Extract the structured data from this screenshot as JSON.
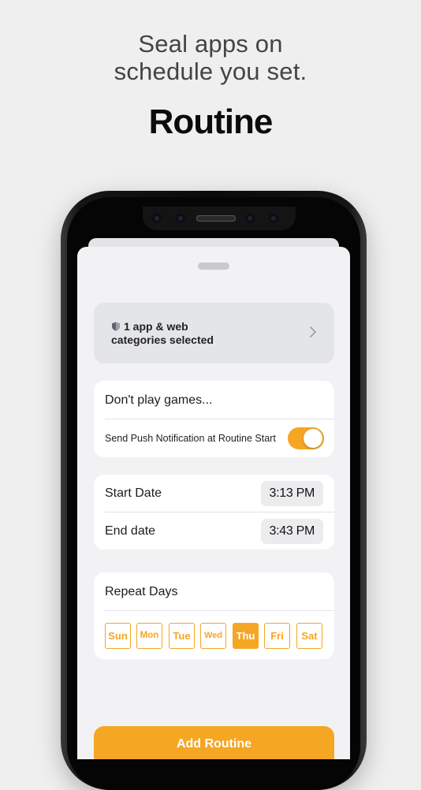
{
  "headline": {
    "line1": "Seal apps on",
    "line2": "schedule you set.",
    "title": "Routine"
  },
  "sheet": {
    "apps_line1": "1 app & web",
    "apps_line2": "categories selected",
    "routine_name": "Don't play games...",
    "push_label": "Send Push Notification at Routine Start",
    "push_enabled": true,
    "start_label": "Start Date",
    "start_time": "3:13 PM",
    "end_label": "End date",
    "end_time": "3:43 PM",
    "repeat_label": "Repeat Days",
    "days": [
      "Sun",
      "Mon",
      "Tue",
      "Wed",
      "Thu",
      "Fri",
      "Sat"
    ],
    "selected_day": "Thu",
    "add_button": "Add Routine"
  },
  "colors": {
    "accent": "#f5a623",
    "background": "#efeff0"
  }
}
